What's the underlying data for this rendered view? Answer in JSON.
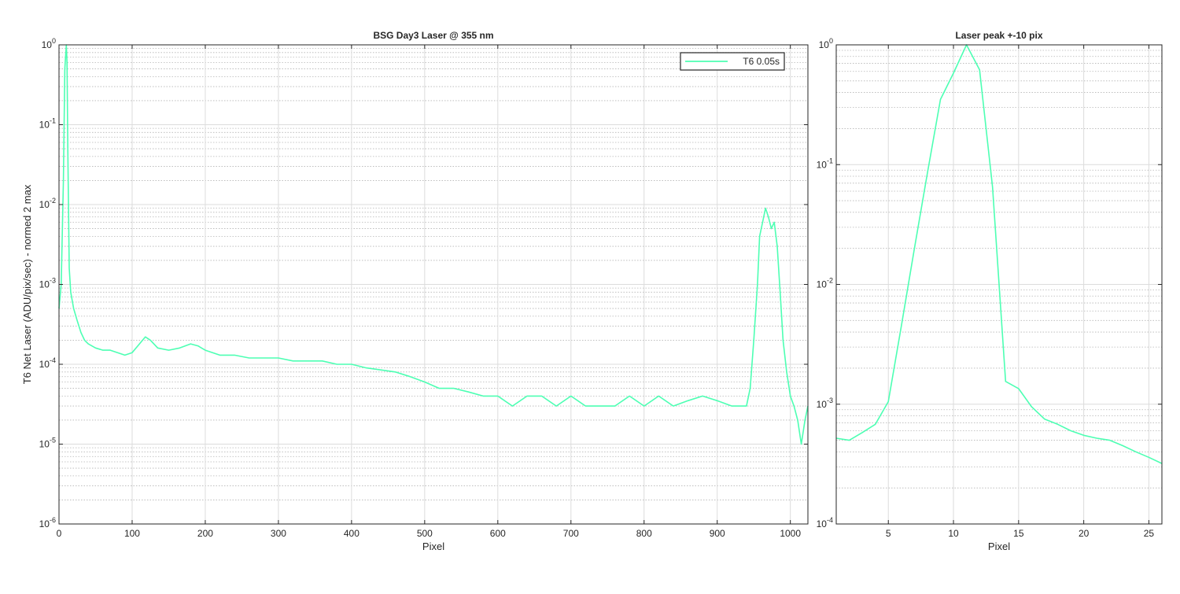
{
  "chart_data": [
    {
      "type": "line",
      "title": "BSG  Day3 Laser @ 355 nm",
      "xlabel": "Pixel",
      "ylabel": "T6 Net Laser (ADU/pix/sec) - normed 2 max",
      "xlim": [
        0,
        1024
      ],
      "ylim": [
        1e-06,
        1
      ],
      "yscale": "log",
      "grid": true,
      "minor_grid": true,
      "legend_position": "top-right",
      "x_ticks": [
        "0",
        "100",
        "200",
        "300",
        "400",
        "500",
        "600",
        "700",
        "800",
        "900",
        "1000"
      ],
      "y_ticks": [
        {
          "base": "10",
          "exp": "-6"
        },
        {
          "base": "10",
          "exp": "-5"
        },
        {
          "base": "10",
          "exp": "-4"
        },
        {
          "base": "10",
          "exp": "-3"
        },
        {
          "base": "10",
          "exp": "-2"
        },
        {
          "base": "10",
          "exp": "-1"
        },
        {
          "base": "10",
          "exp": "0"
        }
      ],
      "series": [
        {
          "name": "T6 0.05s",
          "color": "#4dffb3",
          "x": [
            0,
            3,
            6,
            8,
            10,
            11,
            12,
            14,
            16,
            20,
            25,
            30,
            35,
            40,
            50,
            60,
            70,
            80,
            90,
            100,
            110,
            118,
            125,
            135,
            150,
            165,
            180,
            190,
            200,
            220,
            240,
            260,
            280,
            300,
            320,
            340,
            360,
            380,
            400,
            420,
            440,
            460,
            480,
            500,
            520,
            540,
            560,
            580,
            600,
            620,
            640,
            660,
            680,
            700,
            720,
            740,
            760,
            780,
            800,
            820,
            840,
            860,
            880,
            900,
            920,
            940,
            945,
            950,
            955,
            958,
            962,
            966,
            970,
            974,
            978,
            982,
            986,
            990,
            995,
            1000,
            1005,
            1010,
            1015,
            1020,
            1024
          ],
          "y": [
            0.0005,
            0.001,
            0.02,
            0.5,
            1.0,
            0.6,
            0.05,
            0.0016,
            0.0008,
            0.0005,
            0.00035,
            0.00025,
            0.0002,
            0.00018,
            0.00016,
            0.00015,
            0.00015,
            0.00014,
            0.00013,
            0.00014,
            0.00018,
            0.00022,
            0.0002,
            0.00016,
            0.00015,
            0.00016,
            0.00018,
            0.00017,
            0.00015,
            0.00013,
            0.00013,
            0.00012,
            0.00012,
            0.00012,
            0.00011,
            0.00011,
            0.00011,
            0.0001,
            0.0001,
            9e-05,
            8.5e-05,
            8e-05,
            7e-05,
            6e-05,
            5e-05,
            5e-05,
            4.5e-05,
            4e-05,
            4e-05,
            3e-05,
            4e-05,
            4e-05,
            3e-05,
            4e-05,
            3e-05,
            3e-05,
            3e-05,
            4e-05,
            3e-05,
            4e-05,
            3e-05,
            3.5e-05,
            4e-05,
            3.5e-05,
            3e-05,
            3e-05,
            5e-05,
            0.0002,
            0.001,
            0.004,
            0.006,
            0.009,
            0.007,
            0.005,
            0.006,
            0.003,
            0.0008,
            0.0002,
            8e-05,
            4e-05,
            3e-05,
            2e-05,
            1e-05,
            2e-05,
            3e-05
          ]
        }
      ]
    },
    {
      "type": "line",
      "title": "Laser peak +-10 pix",
      "xlabel": "Pixel",
      "ylabel": "",
      "xlim": [
        1,
        26
      ],
      "ylim": [
        0.0001,
        1
      ],
      "yscale": "log",
      "grid": true,
      "minor_grid": true,
      "x_ticks": [
        "5",
        "10",
        "15",
        "20",
        "25"
      ],
      "y_ticks": [
        {
          "base": "10",
          "exp": "-4"
        },
        {
          "base": "10",
          "exp": "-3"
        },
        {
          "base": "10",
          "exp": "-2"
        },
        {
          "base": "10",
          "exp": "-1"
        },
        {
          "base": "10",
          "exp": "0"
        }
      ],
      "series": [
        {
          "color": "#4dffb3",
          "x": [
            1,
            2,
            3,
            4,
            5,
            6,
            7,
            8,
            9,
            10,
            11,
            12,
            13,
            14,
            15,
            16,
            17,
            18,
            19,
            20,
            21,
            22,
            23,
            24,
            25,
            26
          ],
          "y": [
            0.00052,
            0.0005,
            0.00058,
            0.00068,
            0.00105,
            0.0045,
            0.02,
            0.085,
            0.35,
            0.58,
            1.0,
            0.62,
            0.065,
            0.00155,
            0.00135,
            0.00095,
            0.00075,
            0.00068,
            0.0006,
            0.00055,
            0.00052,
            0.0005,
            0.00045,
            0.0004,
            0.00036,
            0.00032
          ]
        }
      ]
    }
  ]
}
